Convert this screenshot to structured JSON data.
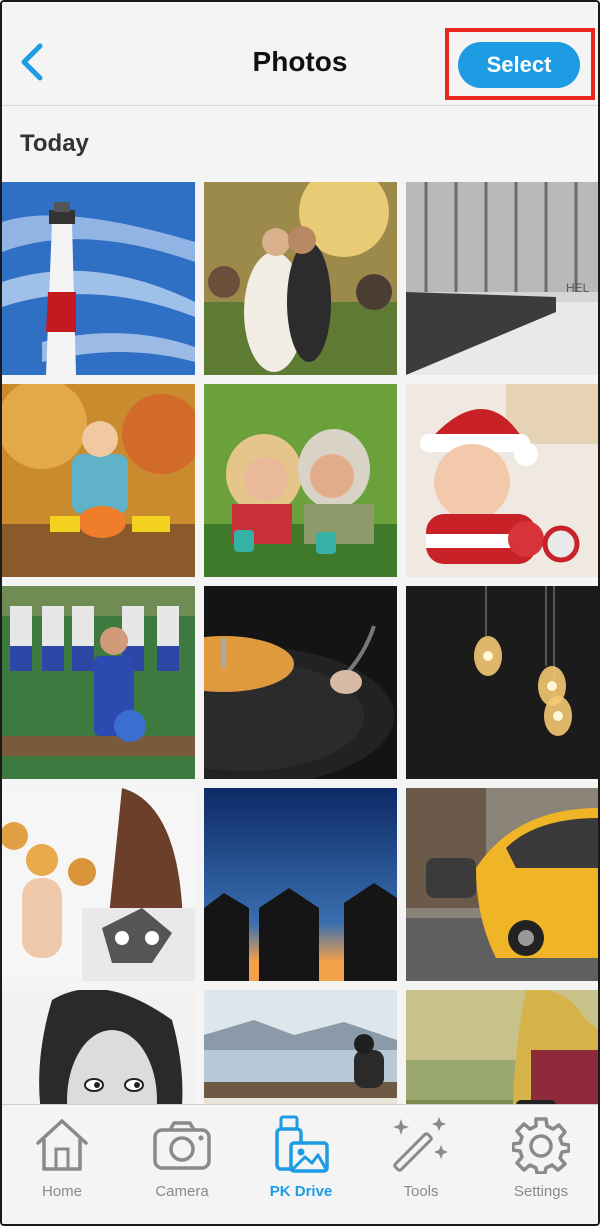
{
  "header": {
    "title": "Photos",
    "select_label": "Select",
    "back_icon": "chevron-left-icon",
    "accent_color": "#1d9be3",
    "highlight_color": "#e8261b"
  },
  "section": {
    "label": "Today"
  },
  "photos": [
    "lighthouse",
    "wedding-couple-kiss",
    "empty-walkway",
    "child-autumn-leaves",
    "two-women-laughing",
    "baby-santa-hat",
    "football-cheerleader",
    "vinyl-record-player",
    "hanging-light-bulbs",
    "girl-donut-fingers",
    "huts-at-dusk",
    "yellow-taxi",
    "woman-portrait-bw",
    "person-on-bench-lake",
    "woman-with-camera"
  ],
  "tabs": [
    {
      "label": "Home",
      "icon": "home-icon",
      "active": false
    },
    {
      "label": "Camera",
      "icon": "camera-icon",
      "active": false
    },
    {
      "label": "PK Drive",
      "icon": "usb-drive-photo-icon",
      "active": true
    },
    {
      "label": "Tools",
      "icon": "magic-wand-icon",
      "active": false
    },
    {
      "label": "Settings",
      "icon": "gear-icon",
      "active": false
    }
  ]
}
